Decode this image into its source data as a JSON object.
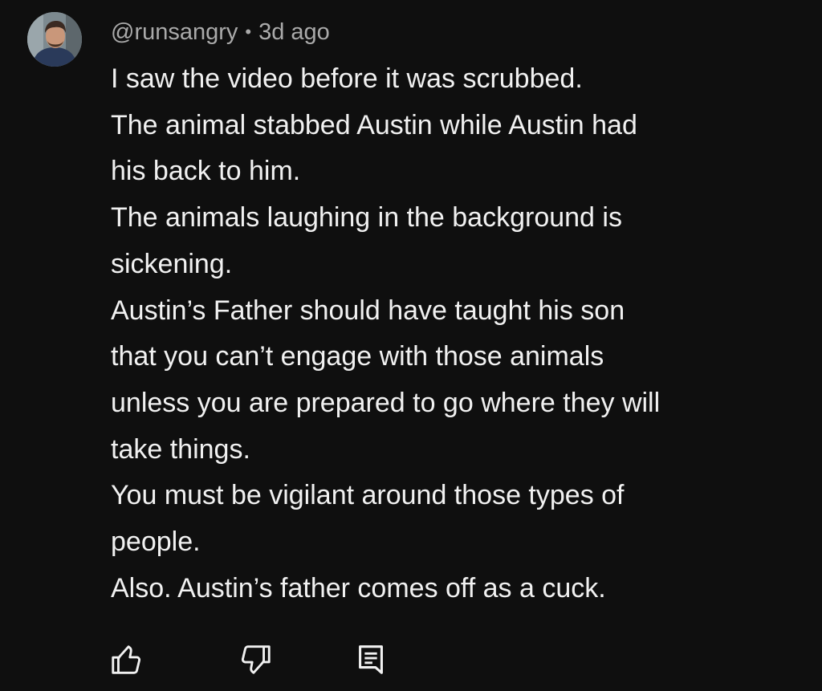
{
  "comment": {
    "author": "@runsangry",
    "separator": "•",
    "timestamp": "3d ago",
    "lines": [
      "I saw the video before it was scrubbed.",
      "The animal stabbed Austin while Austin had",
      "his back to him.",
      "The animals laughing in the background is",
      "sickening.",
      "Austin’s Father should have taught his son",
      "that you can’t engage with those animals",
      "unless you are prepared to go where they will",
      "take things.",
      "You must be vigilant around those types of",
      "people.",
      "Also. Austin’s father comes off as a cuck."
    ]
  },
  "actions": {
    "like_icon": "thumbs-up-icon",
    "dislike_icon": "thumbs-down-icon",
    "reply_icon": "reply-comment-icon"
  },
  "colors": {
    "background": "#0f0f0f",
    "text": "#f1f1f1",
    "meta": "#aaaaaa"
  }
}
